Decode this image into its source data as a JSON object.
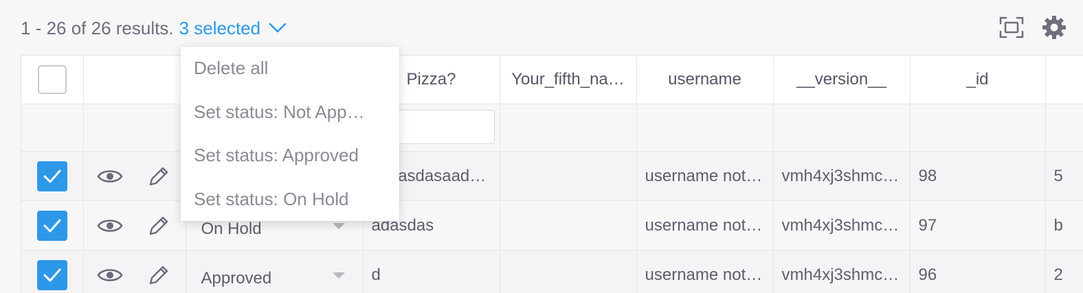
{
  "toolbar": {
    "results_text": "1 - 26 of 26 results.",
    "selected_text": "3 selected",
    "accent_color": "#2d98e8",
    "icons": [
      "fullscreen-icon",
      "gear-icon"
    ]
  },
  "selection_menu": {
    "items": [
      "Delete all",
      "Set status: Not App…",
      "Set status: Approved",
      "Set status: On Hold"
    ]
  },
  "table": {
    "columns": [
      "",
      "",
      "",
      "Pizza?",
      "Your_fifth_na…",
      "username",
      "__version__",
      "_id",
      ""
    ],
    "rows": [
      {
        "checked": true,
        "status": "",
        "pizza": "asdasdasaad…",
        "fifth": "",
        "username": "username not…",
        "version": "vmh4xj3shmc…",
        "id": "98",
        "extra": "5"
      },
      {
        "checked": true,
        "status": "On Hold",
        "pizza": "adasdas",
        "fifth": "",
        "username": "username not…",
        "version": "vmh4xj3shmc…",
        "id": "97",
        "extra": "b"
      },
      {
        "checked": true,
        "status": "Approved",
        "pizza": "d",
        "fifth": "",
        "username": "username not…",
        "version": "vmh4xj3shmc…",
        "id": "96",
        "extra": "2"
      }
    ]
  }
}
